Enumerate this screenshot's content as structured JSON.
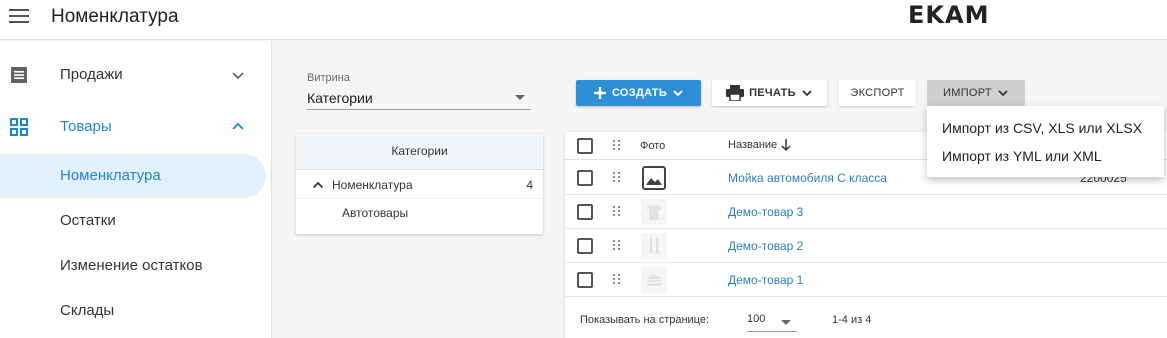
{
  "header": {
    "title": "Номенклатура",
    "logo": "EKAM"
  },
  "sidebar": {
    "items": [
      {
        "label": "Продажи",
        "icon": "receipt-icon"
      },
      {
        "label": "Товары",
        "icon": "grid-icon"
      }
    ],
    "subitems": [
      {
        "label": "Номенклатура",
        "active": true
      },
      {
        "label": "Остатки"
      },
      {
        "label": "Изменение остатков"
      },
      {
        "label": "Склады"
      }
    ]
  },
  "toolbar": {
    "vitrina_label": "Витрина",
    "vitrina_value": "Категории",
    "create_label": "Создать",
    "print_label": "Печать",
    "export_label": "Экспорт",
    "import_label": "Импорт"
  },
  "categories": {
    "header": "Категории",
    "root": {
      "name": "Номенклатура",
      "count": "4"
    },
    "children": [
      "Автотовары"
    ]
  },
  "table": {
    "col_photo": "Фото",
    "col_name": "Название",
    "rows": [
      {
        "name": "Мойка автомобиля С класса",
        "code": "2200025",
        "photo": "image-icon"
      },
      {
        "name": "Демо-товар 3",
        "code": "",
        "photo": "shirt-icon"
      },
      {
        "name": "Демо-товар 2",
        "code": "",
        "photo": "cutlery-icon"
      },
      {
        "name": "Демо-товар 1",
        "code": "",
        "photo": "burger-icon"
      }
    ],
    "footer": {
      "per_page_label": "Показывать на странице:",
      "per_page_value": "100",
      "range": "1-4 из 4"
    }
  },
  "import_menu": {
    "items": [
      "Импорт из CSV, XLS или XLSX",
      "Импорт из YML или XML"
    ]
  },
  "colors": {
    "accent": "#1e88c8",
    "create_button": "#2d8fd5",
    "active_bg": "#e3f0fa",
    "link": "#2a7fb8"
  }
}
